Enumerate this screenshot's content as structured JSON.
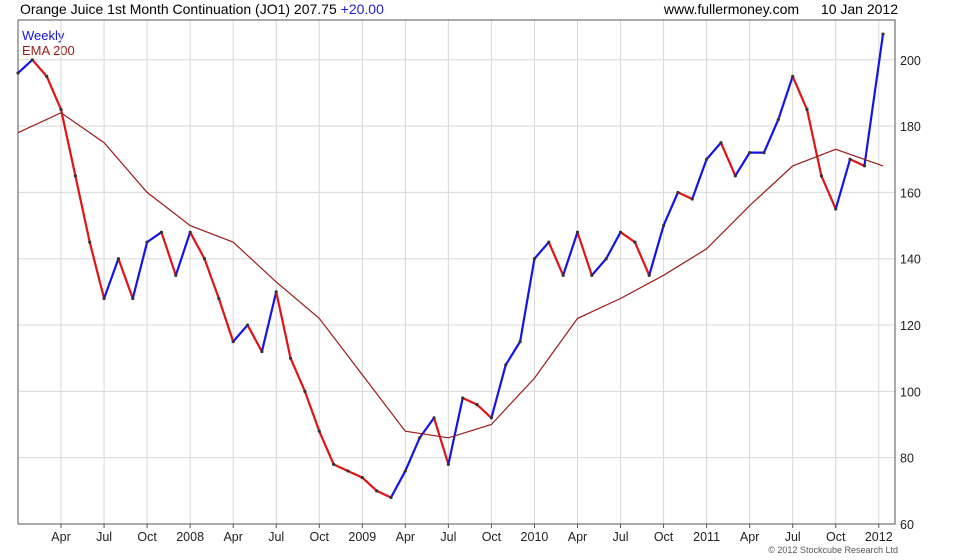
{
  "header": {
    "title": "Orange Juice 1st Month Continuation (JO1)",
    "last": "207.75",
    "change": "+20.00",
    "site": "www.fullermoney.com",
    "date": "10 Jan 2012"
  },
  "legend": {
    "weekly": "Weekly",
    "ema": "EMA 200"
  },
  "copyright": "© 2012 Stockcube Research Ltd",
  "colors": {
    "up": "#1414e6",
    "down": "#e01414",
    "ema": "#9b1c1c",
    "grid": "#d8d8d8",
    "axis": "#555555"
  },
  "chart_data": {
    "type": "line",
    "title": "Orange Juice 1st Month Continuation (JO1)",
    "xlabel": "",
    "ylabel": "",
    "frequency": "weekly",
    "ylim": [
      60,
      212
    ],
    "yticks": [
      60,
      80,
      100,
      120,
      140,
      160,
      180,
      200
    ],
    "x_tick_labels": [
      "Apr",
      "Jul",
      "Oct",
      "2008",
      "Apr",
      "Jul",
      "Oct",
      "2009",
      "Apr",
      "Jul",
      "Oct",
      "2010",
      "Apr",
      "Jul",
      "Oct",
      "2011",
      "Apr",
      "Jul",
      "Oct",
      "2012"
    ],
    "x_tick_dates": [
      "2007-04",
      "2007-07",
      "2007-10",
      "2008-01",
      "2008-04",
      "2008-07",
      "2008-10",
      "2009-01",
      "2009-04",
      "2009-07",
      "2009-10",
      "2010-01",
      "2010-04",
      "2010-07",
      "2010-10",
      "2011-01",
      "2011-04",
      "2011-07",
      "2011-10",
      "2012-01"
    ],
    "x_range": [
      "2007-01",
      "2012-01-10"
    ],
    "series": [
      {
        "name": "Weekly",
        "description": "weekly closing price, approximate (read from bars)",
        "points": [
          [
            "2007-01",
            196
          ],
          [
            "2007-02",
            200
          ],
          [
            "2007-03",
            195
          ],
          [
            "2007-04",
            185
          ],
          [
            "2007-05",
            165
          ],
          [
            "2007-06",
            145
          ],
          [
            "2007-07",
            128
          ],
          [
            "2007-08",
            140
          ],
          [
            "2007-09",
            128
          ],
          [
            "2007-10",
            145
          ],
          [
            "2007-11",
            148
          ],
          [
            "2007-12",
            135
          ],
          [
            "2008-01",
            148
          ],
          [
            "2008-02",
            140
          ],
          [
            "2008-03",
            128
          ],
          [
            "2008-04",
            115
          ],
          [
            "2008-05",
            120
          ],
          [
            "2008-06",
            112
          ],
          [
            "2008-07",
            130
          ],
          [
            "2008-08",
            110
          ],
          [
            "2008-09",
            100
          ],
          [
            "2008-10",
            88
          ],
          [
            "2008-11",
            78
          ],
          [
            "2008-12",
            76
          ],
          [
            "2009-01",
            74
          ],
          [
            "2009-02",
            70
          ],
          [
            "2009-03",
            68
          ],
          [
            "2009-04",
            76
          ],
          [
            "2009-05",
            86
          ],
          [
            "2009-06",
            92
          ],
          [
            "2009-07",
            78
          ],
          [
            "2009-08",
            98
          ],
          [
            "2009-09",
            96
          ],
          [
            "2009-10",
            92
          ],
          [
            "2009-11",
            108
          ],
          [
            "2009-12",
            115
          ],
          [
            "2010-01",
            140
          ],
          [
            "2010-02",
            145
          ],
          [
            "2010-03",
            135
          ],
          [
            "2010-04",
            148
          ],
          [
            "2010-05",
            135
          ],
          [
            "2010-06",
            140
          ],
          [
            "2010-07",
            148
          ],
          [
            "2010-08",
            145
          ],
          [
            "2010-09",
            135
          ],
          [
            "2010-10",
            150
          ],
          [
            "2010-11",
            160
          ],
          [
            "2010-12",
            158
          ],
          [
            "2011-01",
            170
          ],
          [
            "2011-02",
            175
          ],
          [
            "2011-03",
            165
          ],
          [
            "2011-04",
            172
          ],
          [
            "2011-05",
            172
          ],
          [
            "2011-06",
            182
          ],
          [
            "2011-07",
            195
          ],
          [
            "2011-08",
            185
          ],
          [
            "2011-09",
            165
          ],
          [
            "2011-10",
            155
          ],
          [
            "2011-11",
            170
          ],
          [
            "2011-12",
            168
          ],
          [
            "2012-01-10",
            207.75
          ]
        ]
      },
      {
        "name": "EMA 200",
        "points": [
          [
            "2007-01",
            178
          ],
          [
            "2007-04",
            184
          ],
          [
            "2007-07",
            175
          ],
          [
            "2007-10",
            160
          ],
          [
            "2008-01",
            150
          ],
          [
            "2008-04",
            145
          ],
          [
            "2008-07",
            133
          ],
          [
            "2008-10",
            122
          ],
          [
            "2009-01",
            105
          ],
          [
            "2009-04",
            88
          ],
          [
            "2009-07",
            86
          ],
          [
            "2009-10",
            90
          ],
          [
            "2010-01",
            104
          ],
          [
            "2010-04",
            122
          ],
          [
            "2010-07",
            128
          ],
          [
            "2010-10",
            135
          ],
          [
            "2011-01",
            143
          ],
          [
            "2011-04",
            156
          ],
          [
            "2011-07",
            168
          ],
          [
            "2011-10",
            173
          ],
          [
            "2012-01-10",
            168
          ]
        ]
      }
    ]
  }
}
